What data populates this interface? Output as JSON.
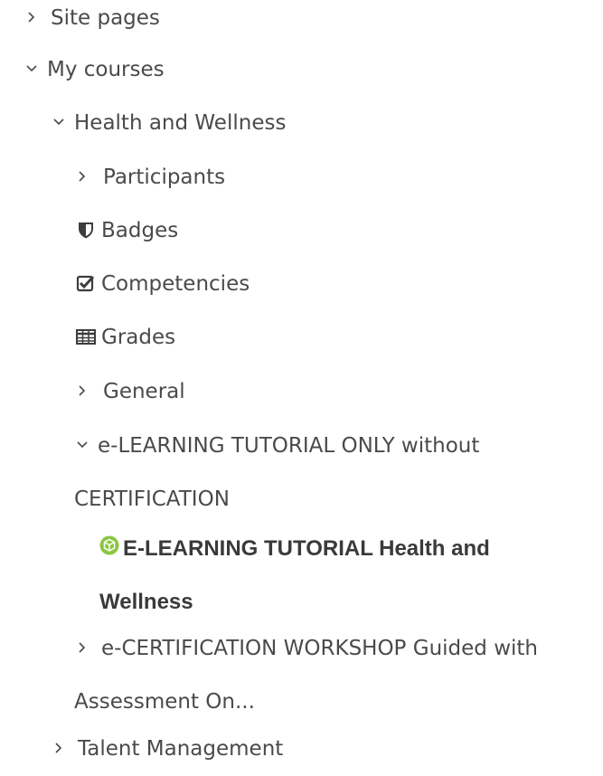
{
  "nav": {
    "site_pages": {
      "label": "Site pages",
      "state": "collapsed"
    },
    "my_courses": {
      "label": "My courses",
      "state": "expanded"
    },
    "health_and_wellness": {
      "label": "Health and Wellness",
      "state": "expanded"
    },
    "participants": {
      "label": "Participants",
      "state": "collapsed"
    },
    "badges": {
      "label": "Badges",
      "icon": "shield-icon"
    },
    "competencies": {
      "label": "Competencies",
      "icon": "check-square-icon"
    },
    "grades": {
      "label": "Grades",
      "icon": "table-icon"
    },
    "general": {
      "label": "General",
      "state": "collapsed"
    },
    "elearning_section": {
      "label_line1": "e-LEARNING TUTORIAL ONLY without",
      "label_line2": "CERTIFICATION",
      "state": "expanded"
    },
    "elearning_activity": {
      "label_line1": "E-LEARNING TUTORIAL Health and",
      "label_line2": "Wellness",
      "icon": "scorm-package-icon",
      "icon_color": "#8cc63f",
      "active": true
    },
    "ecertification_section": {
      "label_line1": "e-CERTIFICATION WORKSHOP Guided with",
      "label_line2": "Assessment On...",
      "state": "collapsed"
    },
    "talent_management": {
      "label": "Talent Management",
      "state": "collapsed"
    }
  },
  "colors": {
    "text": "#4a4a4a",
    "active_text": "#3a3a3a",
    "icon_green": "#8cc63f"
  }
}
